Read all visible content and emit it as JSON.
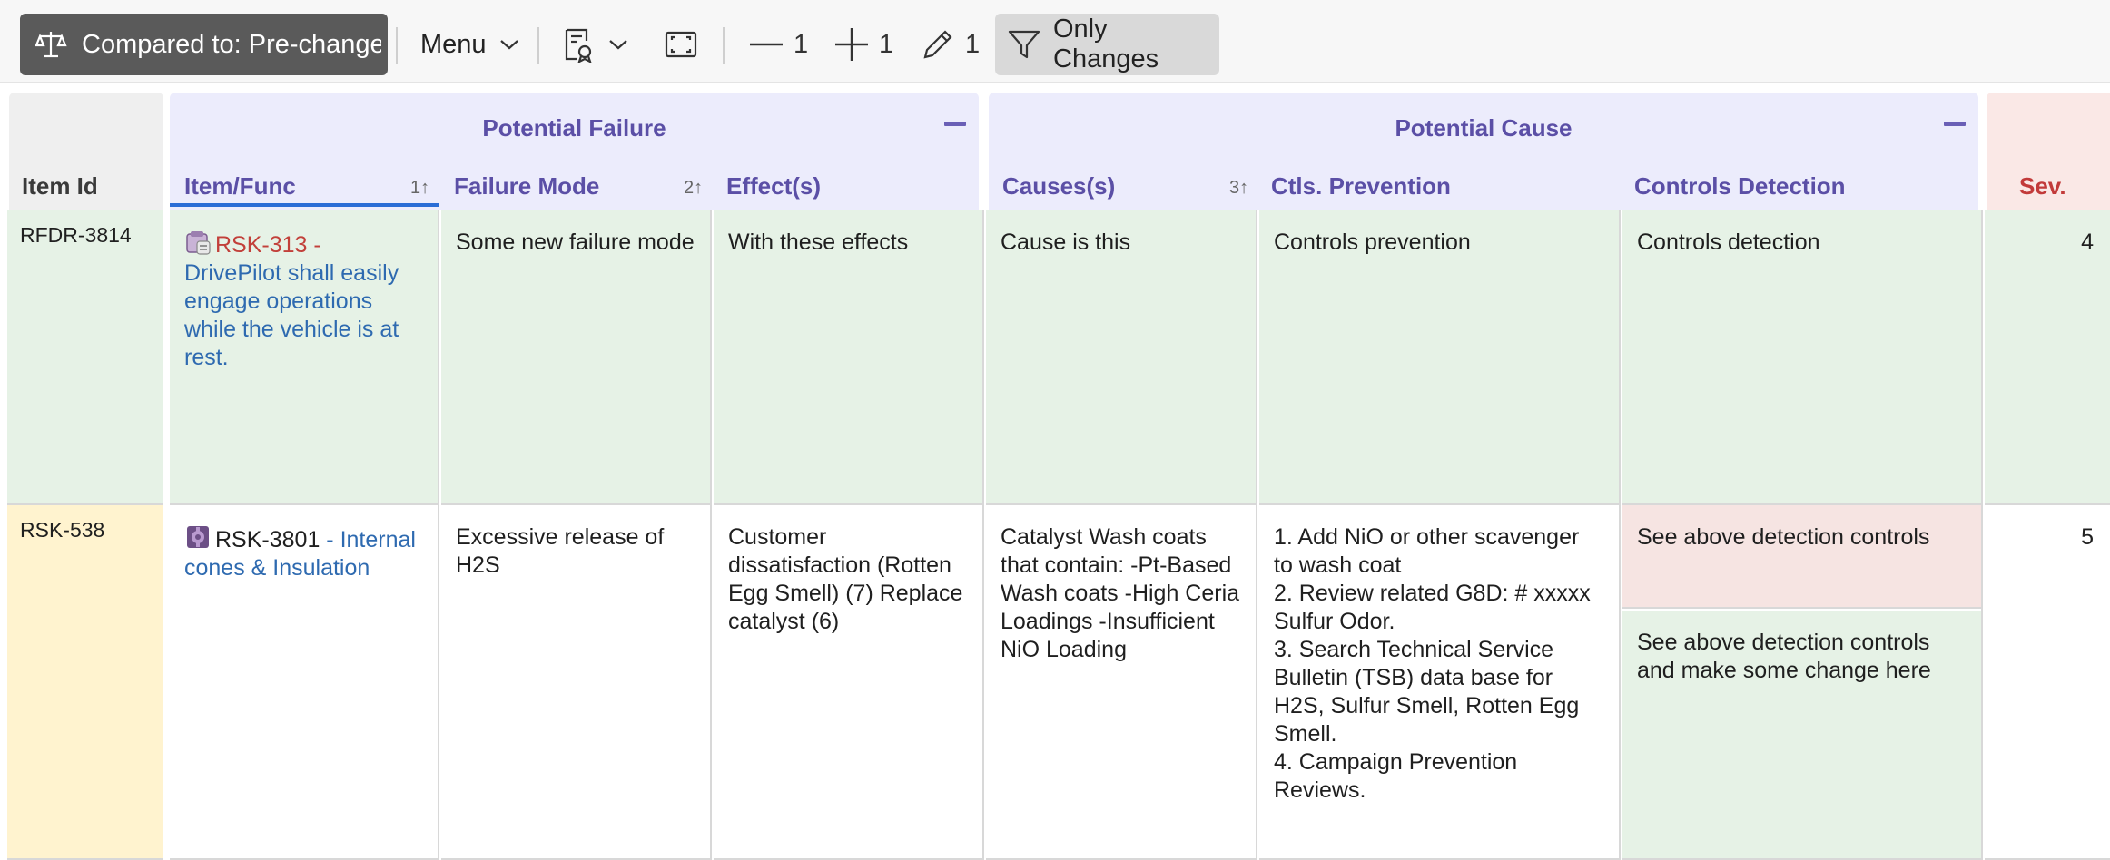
{
  "toolbar": {
    "compare_label": "Compared to: Pre-changes",
    "menu_label": "Menu",
    "deleted_count": "1",
    "added_count": "1",
    "edited_count": "1",
    "only_changes_label": "Only Changes"
  },
  "header": {
    "id_col": "Item Id",
    "group_failure": "Potential Failure",
    "group_cause": "Potential Cause",
    "col_item": "Item/Func",
    "col_item_sort": "1↑",
    "col_failure_mode": "Failure Mode",
    "col_failure_mode_sort": "2↑",
    "col_effects": "Effect(s)",
    "col_causes": "Causes(s)",
    "col_causes_sort": "3↑",
    "col_prevention": "Ctls. Prevention",
    "col_detection": "Controls Detection",
    "col_sev": "Sev."
  },
  "rows": [
    {
      "id": "RFDR-3814",
      "item_key": "RSK-313",
      "item_text": "DrivePilot shall easily engage operations while the vehicle is at rest.",
      "failure_mode": "Some new failure mode",
      "effects": "With these effects",
      "causes": "Cause is this",
      "prevention": "Controls prevention",
      "detection": "Controls detection",
      "sev": "4"
    },
    {
      "id": "RSK-538",
      "item_key": "RSK-3801",
      "item_text": "Internal cones & Insulation",
      "failure_mode": "Excessive release of H2S",
      "effects": "Customer dissatisfaction (Rotten Egg Smell) (7) Replace catalyst (6)",
      "causes": "Catalyst Wash coats that contain: -Pt-Based Wash coats -High Ceria Loadings -Insufficient NiO Loading",
      "prevention": [
        "1. Add NiO or other scavenger to wash coat",
        "2. Review related G8D: # xxxxx Sulfur Odor.",
        "3. Search Technical Service Bulletin (TSB) data base for H2S, Sulfur Smell, Rotten Egg Smell.",
        "4. Campaign Prevention Reviews."
      ],
      "detection_old": "See above detection controls",
      "detection_new": "See above detection controls and make some change here",
      "sev": "5"
    }
  ],
  "colors": {
    "added": "#e6f2e6",
    "removed": "#f6e4e2",
    "modified_id": "#fff3cf",
    "group_header": "#ececfc",
    "accent_text": "#5b4fa6"
  }
}
